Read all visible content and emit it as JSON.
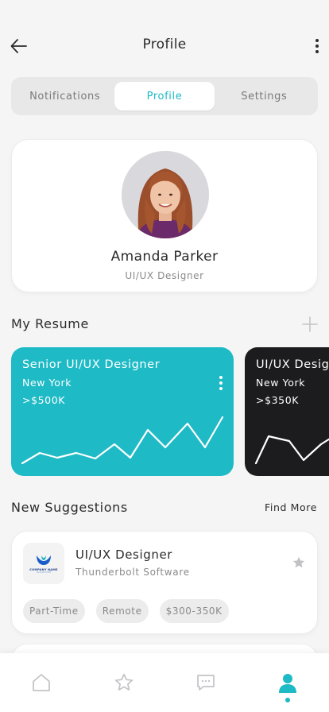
{
  "header": {
    "title": "Profile",
    "back_icon": "arrow-left-icon",
    "more_icon": "more-vertical-icon"
  },
  "tabs": [
    {
      "label": "Notifications",
      "active": false
    },
    {
      "label": "Profile",
      "active": true
    },
    {
      "label": "Settings",
      "active": false
    }
  ],
  "profile": {
    "name": "Amanda Parker",
    "role": "UI/UX Designer",
    "avatar_icon": "profile-photo"
  },
  "resume": {
    "title": "My Resume",
    "add_icon": "plus-icon",
    "cards": [
      {
        "title": "Senior UI/UX Designer",
        "city": "New York",
        "salary": ">$500K",
        "color": "#1ebac6"
      },
      {
        "title": "UI/UX Designer",
        "city": "New York",
        "salary": ">$350K",
        "color": "#1c1c1e"
      }
    ]
  },
  "suggestions": {
    "title": "New Suggestions",
    "find_more": "Find More",
    "items": [
      {
        "job_title": "UI/UX Designer",
        "company": "Thunderbolt Software",
        "logo_text": "COMPANY NAME",
        "logo_subtext": "SLOGAN HERE",
        "tags": [
          "Part-Time",
          "Remote",
          "$300-350K"
        ],
        "bookmark_icon": "star-icon"
      }
    ]
  },
  "bottom_nav": {
    "items": [
      {
        "icon": "home-icon",
        "active": false
      },
      {
        "icon": "star-icon",
        "active": false
      },
      {
        "icon": "chat-icon",
        "active": false
      },
      {
        "icon": "user-icon",
        "active": true
      }
    ]
  },
  "colors": {
    "accent": "#1ebac6",
    "dark_card": "#1c1c1e",
    "background": "#f5f5f5"
  }
}
